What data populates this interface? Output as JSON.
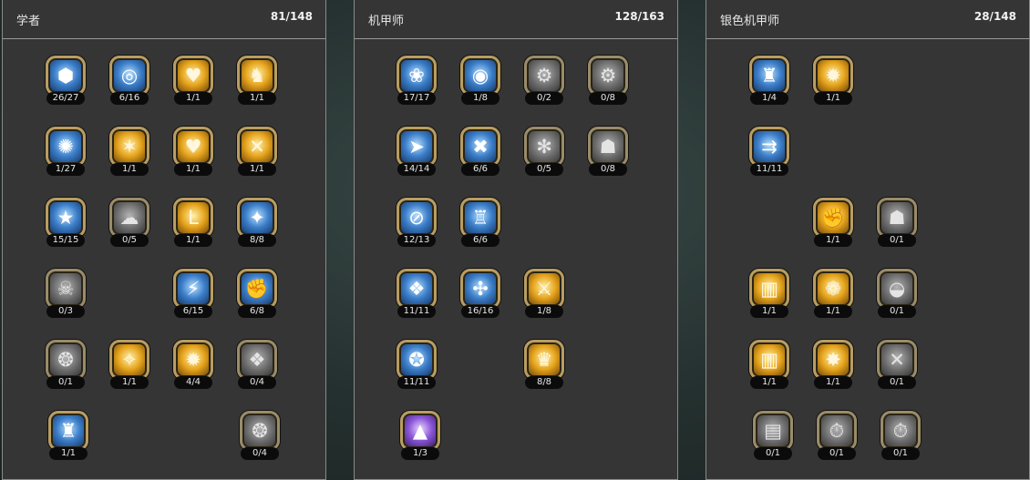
{
  "panels": [
    {
      "title": "学者",
      "points": "81/148",
      "skills": [
        {
          "icon": "dice-icon",
          "glyph": "⬢",
          "style": "blue",
          "count": "26/27"
        },
        {
          "icon": "ring-icon",
          "glyph": "◎",
          "style": "blue",
          "count": "6/16"
        },
        {
          "icon": "heart-icon",
          "glyph": "♥",
          "style": "gold",
          "count": "1/1"
        },
        {
          "icon": "boot-icon",
          "glyph": "♞",
          "style": "gold",
          "count": "1/1"
        },
        {
          "icon": "flame-icon",
          "glyph": "✺",
          "style": "blue",
          "count": "1/27"
        },
        {
          "icon": "figure-icon",
          "glyph": "✶",
          "style": "gold",
          "count": "1/1"
        },
        {
          "icon": "air-heart-icon",
          "glyph": "♥",
          "style": "gold",
          "count": "1/1"
        },
        {
          "icon": "crossed-swords-icon",
          "glyph": "✕",
          "style": "gold",
          "count": "1/1"
        },
        {
          "icon": "star-icon",
          "glyph": "★",
          "style": "blue",
          "count": "15/15"
        },
        {
          "icon": "shadow-icon",
          "glyph": "☁",
          "style": "gray",
          "count": "0/5"
        },
        {
          "icon": "arm-icon",
          "glyph": "ᒪ",
          "style": "gold",
          "count": "1/1"
        },
        {
          "icon": "sparkle-icon",
          "glyph": "✦",
          "style": "blue",
          "count": "8/8"
        },
        {
          "icon": "skull-icon",
          "glyph": "☠",
          "style": "gray",
          "count": "0/3"
        },
        {
          "icon": "runner-icon",
          "glyph": "⚡",
          "style": "blue",
          "count": "6/15"
        },
        {
          "icon": "fist-icon",
          "glyph": "✊",
          "style": "blue",
          "count": "6/8"
        },
        {
          "icon": "beast-icon",
          "glyph": "❂",
          "style": "gray",
          "count": "0/1"
        },
        {
          "icon": "dancer-icon",
          "glyph": "✧",
          "style": "gold",
          "count": "1/1"
        },
        {
          "icon": "hp-burst-icon",
          "glyph": "✹",
          "style": "gold",
          "count": "4/4"
        },
        {
          "icon": "vortex-icon",
          "glyph": "❖",
          "style": "gray",
          "count": "0/4"
        },
        {
          "icon": "totem-icon",
          "glyph": "♜",
          "style": "blue",
          "count": "1/1"
        },
        {
          "icon": "mask-icon",
          "glyph": "❂",
          "style": "gray",
          "count": "0/4"
        }
      ]
    },
    {
      "title": "机甲师",
      "points": "128/163",
      "skills": [
        {
          "icon": "shell-icon",
          "glyph": "❀",
          "style": "blue",
          "count": "17/17"
        },
        {
          "icon": "orb-icon",
          "glyph": "◉",
          "style": "blue",
          "count": "1/8"
        },
        {
          "icon": "gear-icon",
          "glyph": "⚙",
          "style": "gray",
          "count": "0/2"
        },
        {
          "icon": "gear-icon",
          "glyph": "⚙",
          "style": "gray",
          "count": "0/8"
        },
        {
          "icon": "laser-icon",
          "glyph": "➤",
          "style": "blue",
          "count": "14/14"
        },
        {
          "icon": "wrench-icon",
          "glyph": "✖",
          "style": "blue",
          "count": "6/6"
        },
        {
          "icon": "cog-icon",
          "glyph": "✻",
          "style": "gray",
          "count": "0/5"
        },
        {
          "icon": "robot-icon",
          "glyph": "☗",
          "style": "gray",
          "count": "0/8"
        },
        {
          "icon": "no-entry-icon",
          "glyph": "⊘",
          "style": "blue",
          "count": "12/13"
        },
        {
          "icon": "tower-icon",
          "glyph": "♖",
          "style": "blue",
          "count": "6/6"
        },
        {
          "icon": "core-icon",
          "glyph": "❖",
          "style": "blue",
          "count": "11/11"
        },
        {
          "icon": "network-icon",
          "glyph": "✣",
          "style": "blue",
          "count": "16/16"
        },
        {
          "icon": "slash-icon",
          "glyph": "⚔",
          "style": "gold",
          "count": "1/8"
        },
        {
          "icon": "swirl-icon",
          "glyph": "✪",
          "style": "blue",
          "count": "11/11"
        },
        {
          "icon": "crown-icon",
          "glyph": "♛",
          "style": "gold",
          "count": "8/8"
        },
        {
          "icon": "pyramid-icon",
          "glyph": "▲",
          "style": "purple",
          "count": "1/3"
        }
      ]
    },
    {
      "title": "银色机甲师",
      "points": "28/148",
      "skills": [
        {
          "icon": "mech-icon",
          "glyph": "♜",
          "style": "blue",
          "count": "1/4"
        },
        {
          "icon": "wheel-icon",
          "glyph": "✹",
          "style": "gold",
          "count": "1/1"
        },
        {
          "icon": "cannon-icon",
          "glyph": "⇉",
          "style": "blue",
          "count": "11/11"
        },
        {
          "icon": "fist-icon",
          "glyph": "✊",
          "style": "gold",
          "count": "1/1"
        },
        {
          "icon": "drone-icon",
          "glyph": "☗",
          "style": "gray",
          "count": "0/1"
        },
        {
          "icon": "panel-icon",
          "glyph": "▥",
          "style": "gold",
          "count": "1/1"
        },
        {
          "icon": "cluster-icon",
          "glyph": "❁",
          "style": "gold",
          "count": "1/1"
        },
        {
          "icon": "disc-icon",
          "glyph": "◒",
          "style": "gray",
          "count": "0/1"
        },
        {
          "icon": "panel-icon",
          "glyph": "▥",
          "style": "gold",
          "count": "1/1"
        },
        {
          "icon": "starburst-icon",
          "glyph": "✸",
          "style": "gold",
          "count": "1/1"
        },
        {
          "icon": "crossed-blades-icon",
          "glyph": "✕",
          "style": "gray",
          "count": "0/1"
        },
        {
          "icon": "pillar-icon",
          "glyph": "▤",
          "style": "gray",
          "count": "0/1"
        },
        {
          "icon": "clock-icon",
          "glyph": "⏱",
          "style": "gray",
          "count": "0/1"
        },
        {
          "icon": "clock-icon",
          "glyph": "⏱",
          "style": "gray",
          "count": "0/1"
        }
      ]
    }
  ]
}
